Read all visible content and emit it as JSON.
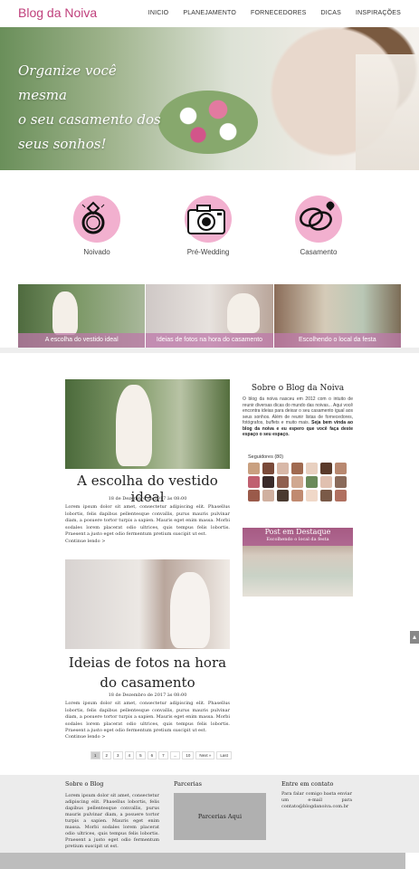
{
  "header": {
    "logo": "Blog da Noiva",
    "nav": [
      "INICIO",
      "PLANEJAMENTO",
      "FORNECEDORES",
      "DICAS",
      "INSPIRAÇÕES"
    ]
  },
  "hero": {
    "line1": "Organize você mesma",
    "line2": "o seu casamento dos",
    "line3": "seus sonhos!"
  },
  "categories": [
    {
      "label": "Noivado",
      "icon": "ring-icon"
    },
    {
      "label": "Pré-Wedding",
      "icon": "camera-icon"
    },
    {
      "label": "Casamento",
      "icon": "wedding-rings-icon"
    }
  ],
  "featured_thumbs": [
    "A escolha do vestido ideal",
    "Ideias de fotos na hora do casamento",
    "Escolhendo o local da festa"
  ],
  "posts": [
    {
      "title": "A escolha do vestido ideal",
      "date": "18 de Dezembro de 2017 às 08:00",
      "body": "Lorem ipsum dolor sit amet, consectetur adipiscing elit. Phasellus lobortis, felis dapibus pellentesque convallis, purus mauris pulvinar diam, a posuere tortor turpis a sapien. Mauris eget enim massa. Morbi sodales lorem placerat odio ultrices, quis tempus felis lobortis. Praesent a justo eget odio fermentum pretium suscipit ut est.",
      "more": "Continue lendo >"
    },
    {
      "title_line1": "Ideias de fotos na hora",
      "title_line2": "do casamento",
      "date": "18 de Dezembro de 2017 às 08:00",
      "body": "Lorem ipsum dolor sit amet, consectetur adipiscing elit. Phasellus lobortis, felis dapibus pellentesque convallis, purus mauris pulvinar diam, a posuere tortor turpis a sapien. Mauris eget enim massa. Morbi sodales lorem placerat odio ultrices, quis tempus felis lobortis. Praesent a justo eget odio fermentum pretium suscipit ut est.",
      "more": "Continue lendo >"
    }
  ],
  "sidebar": {
    "title": "Sobre o Blog da Noiva",
    "text": "O blog da noiva nasceu em 2012 com o intuito de reunir diversas dicas do mundo das noivas... Aqui você encontra ideias para deixar o seu casamento igual aos seus sonhos. Além de reunir listas de fornecedores, fotógrafos, buffets e muito mais.",
    "text_bold": "Seja bem vinda ao blog da noiva e eu espero que você faça deste espaço o seu espaço.",
    "followers_label": "Seguidores (80)",
    "featured_title": "Post em Destaque",
    "featured_sub": "Escolhendo o local da festa",
    "avatar_colors": [
      "#c9a080",
      "#7a4a3a",
      "#d8b8a8",
      "#a06a50",
      "#e8d0c0",
      "#5a3a2a",
      "#b88870",
      "#c06070",
      "#3a2a2a",
      "#906050",
      "#d0a890",
      "#6a8a5a",
      "#e0c0b0",
      "#8a6a5a",
      "#9a5a4a",
      "#d0b0a0",
      "#4a3a30",
      "#c08a70",
      "#f0d8c8",
      "#7a5a48",
      "#b07060"
    ]
  },
  "pagination": [
    "1",
    "2",
    "3",
    "4",
    "5",
    "6",
    "7",
    "...",
    "10",
    "Next »",
    "Last"
  ],
  "footer": {
    "col1_title": "Sobre o Blog",
    "col1_text": "Lorem ipsum dolor sit amet, consectetur adipiscing elit. Phasellus lobortis, felis dapibus pellentesque convallis, purus mauris pulvinar diam, a posuere tortor turpis a sapien. Mauris eget enim massa. Morbi sodales lorem placerat odio ultrices, quis tempus felis lobortis. Praesent a justo eget odio fermentum pretium suscipit ut est.",
    "col2_title": "Parcerias",
    "col2_box": "Parcerias Aqui",
    "col3_title": "Entre em contato",
    "col3_text": "Para falar comigo basta enviar um e-mail para contato@blogdanoiva.com.br"
  }
}
